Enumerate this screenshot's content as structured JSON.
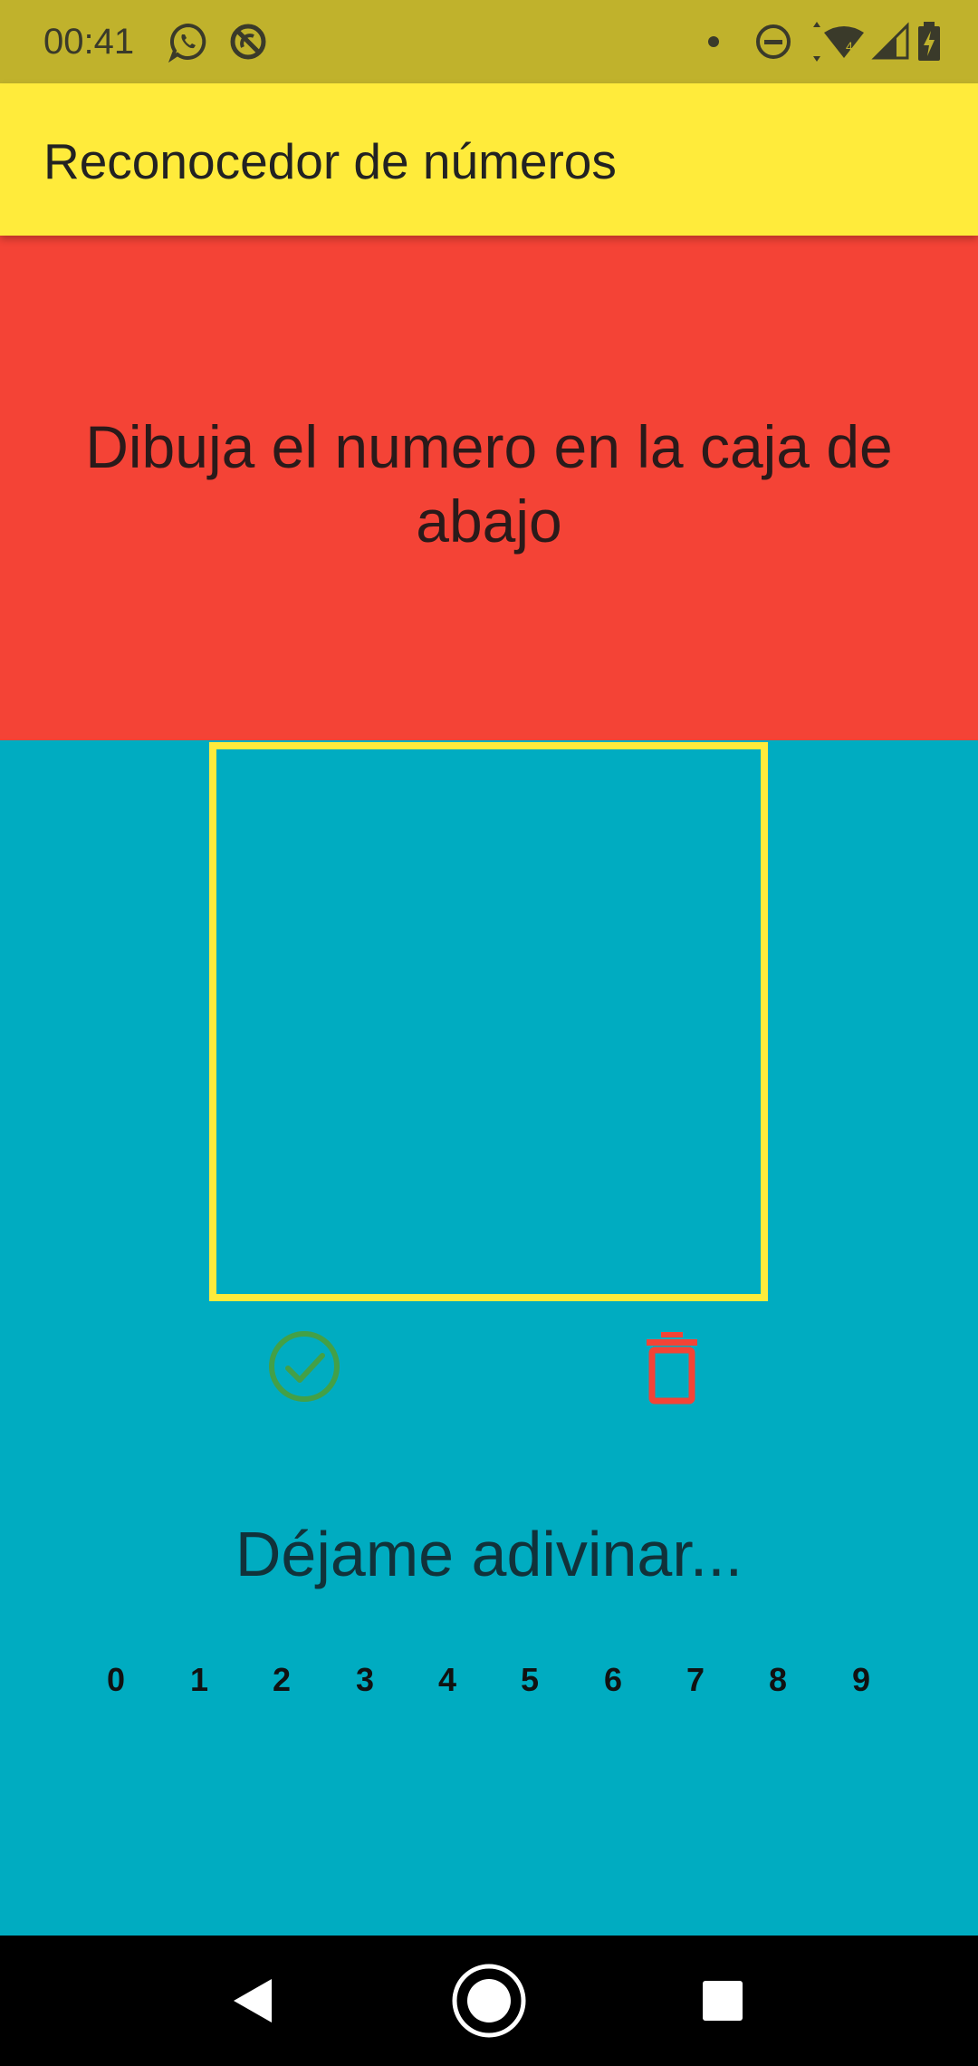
{
  "status_bar": {
    "time": "00:41",
    "notification_icons": [
      "whatsapp-icon",
      "sync-off-icon"
    ],
    "system_icons": [
      "dot-icon",
      "do-not-disturb-icon",
      "wifi-icon",
      "signal-icon",
      "battery-charging-icon"
    ],
    "background_color": "#c0b22c"
  },
  "app_bar": {
    "title": "Reconocedor de números",
    "background_color": "#ffeb3b"
  },
  "instruction": {
    "text": "Dibuja el numero en la caja de abajo",
    "background_color": "#f44336"
  },
  "canvas": {
    "border_color": "#ffeb3b",
    "background_color": "#00acc1"
  },
  "actions": {
    "confirm_icon": "check-circle-icon",
    "confirm_color": "#43a047",
    "clear_icon": "trash-icon",
    "clear_color": "#f44336"
  },
  "result": {
    "guess_text": "Déjame adivinar...",
    "digits": [
      "0",
      "1",
      "2",
      "3",
      "4",
      "5",
      "6",
      "7",
      "8",
      "9"
    ]
  },
  "nav_bar": {
    "buttons": [
      "back-icon",
      "home-icon",
      "recents-icon"
    ]
  }
}
